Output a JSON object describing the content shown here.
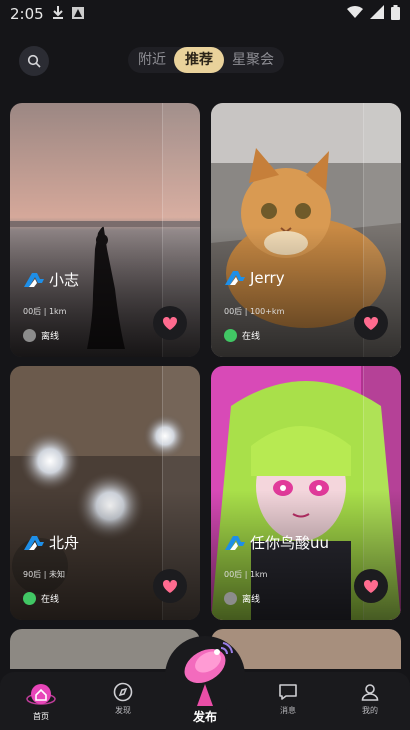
{
  "status_bar": {
    "time": "2:05"
  },
  "top_nav": {
    "tabs": [
      {
        "label": "附近",
        "active": false
      },
      {
        "label": "推荐",
        "active": true
      },
      {
        "label": "星聚会",
        "active": false
      }
    ]
  },
  "cards": [
    {
      "name": "小志",
      "meta": "00后 | 1km",
      "status": "离线",
      "online": false,
      "scene": "sunset beach silhouette"
    },
    {
      "name": "Jerry",
      "meta": "00后 | 100+km",
      "status": "在线",
      "online": true,
      "scene": "orange tabby cat"
    },
    {
      "name": "北舟",
      "meta": "90后 | 未知",
      "status": "在线",
      "online": true,
      "scene": "blurry bokeh lights"
    },
    {
      "name": "任你鸟酸uu",
      "meta": "00后 | 1km",
      "status": "离线",
      "online": false,
      "scene": "anime girl green hair"
    }
  ],
  "bottom_nav": {
    "items": [
      {
        "label": "首页",
        "icon": "home-icon",
        "active": true
      },
      {
        "label": "发现",
        "icon": "compass-icon",
        "active": false
      },
      {
        "label": "发布",
        "icon": "satellite-dish-icon",
        "active": false
      },
      {
        "label": "消息",
        "icon": "message-icon",
        "active": false
      },
      {
        "label": "我的",
        "icon": "user-icon",
        "active": false
      }
    ]
  },
  "colors": {
    "accent": "#e9d29b",
    "online": "#41c764",
    "offline": "#8c8c8c",
    "like": "#ff6b8f",
    "home_accent": "#e845b9"
  }
}
